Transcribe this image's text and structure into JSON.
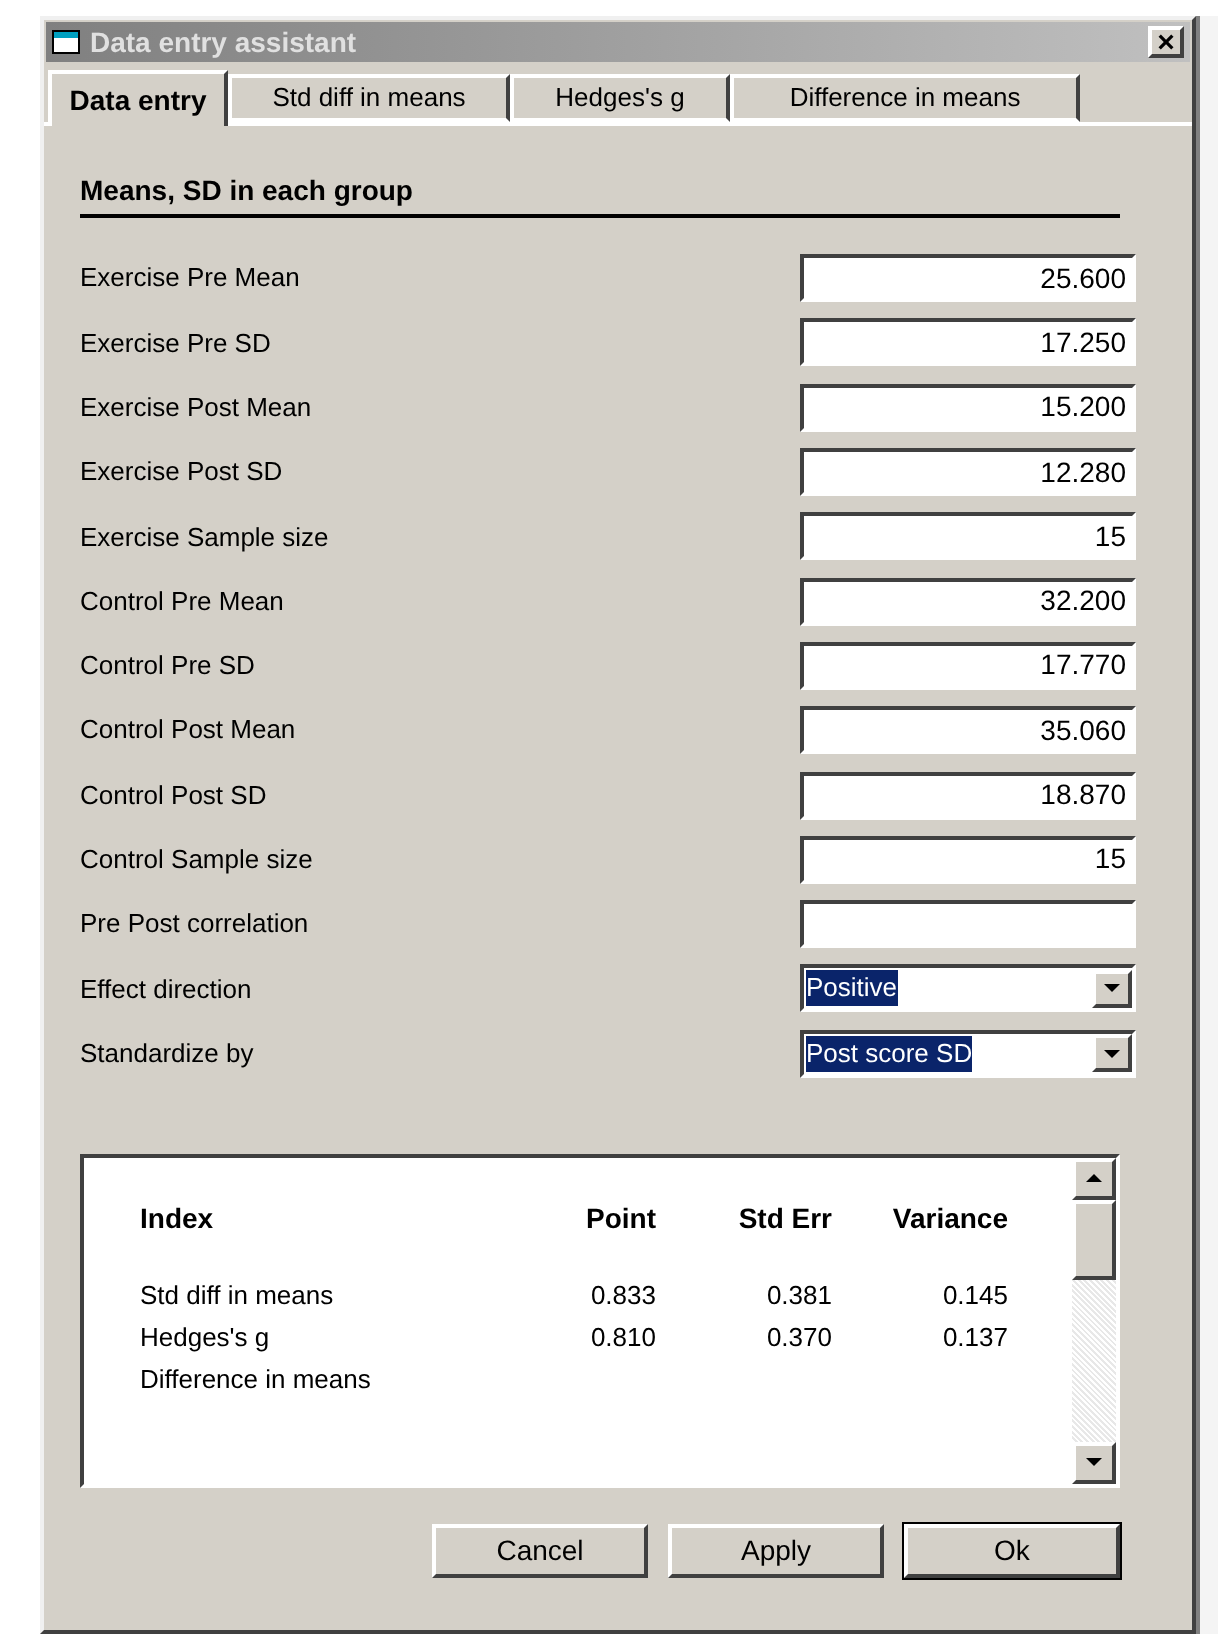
{
  "window": {
    "title": "Data entry assistant",
    "close": "×"
  },
  "tabs": [
    {
      "label": "Data entry",
      "selected": true
    },
    {
      "label": "Std diff in means",
      "selected": false
    },
    {
      "label": "Hedges's g",
      "selected": false
    },
    {
      "label": "Difference in means",
      "selected": false
    }
  ],
  "section_title": "Means, SD in each group",
  "fields": [
    {
      "kind": "text",
      "label": "Exercise Pre Mean",
      "value": "25.600"
    },
    {
      "kind": "text",
      "label": "Exercise Pre SD",
      "value": "17.250"
    },
    {
      "kind": "text",
      "label": "Exercise Post Mean",
      "value": "15.200"
    },
    {
      "kind": "text",
      "label": "Exercise Post SD",
      "value": "12.280"
    },
    {
      "kind": "text",
      "label": "Exercise Sample size",
      "value": "15"
    },
    {
      "kind": "text",
      "label": "Control Pre Mean",
      "value": "32.200"
    },
    {
      "kind": "text",
      "label": "Control Pre SD",
      "value": "17.770"
    },
    {
      "kind": "text",
      "label": "Control Post Mean",
      "value": "35.060"
    },
    {
      "kind": "text",
      "label": "Control Post SD",
      "value": "18.870"
    },
    {
      "kind": "text",
      "label": "Control Sample size",
      "value": "15"
    },
    {
      "kind": "text",
      "label": "Pre Post correlation"
    },
    {
      "kind": "dropdown",
      "label": "Effect direction",
      "value": "Positive",
      "text_selected": true
    },
    {
      "kind": "dropdown",
      "label": "Standardize by",
      "value": "Post score SD",
      "text_selected": true
    }
  ],
  "results": {
    "columns": [
      "Index",
      "Point",
      "Std Err",
      "Variance"
    ],
    "rows": [
      [
        "Std diff in means",
        "0.833",
        "0.381",
        "0.145"
      ],
      [
        "Hedges's g",
        "0.810",
        "0.370",
        "0.137"
      ],
      [
        "Difference in means"
      ]
    ]
  },
  "buttons": [
    {
      "label": "Cancel",
      "default": false
    },
    {
      "label": "Apply",
      "default": false
    },
    {
      "label": "Ok",
      "default": true
    }
  ]
}
